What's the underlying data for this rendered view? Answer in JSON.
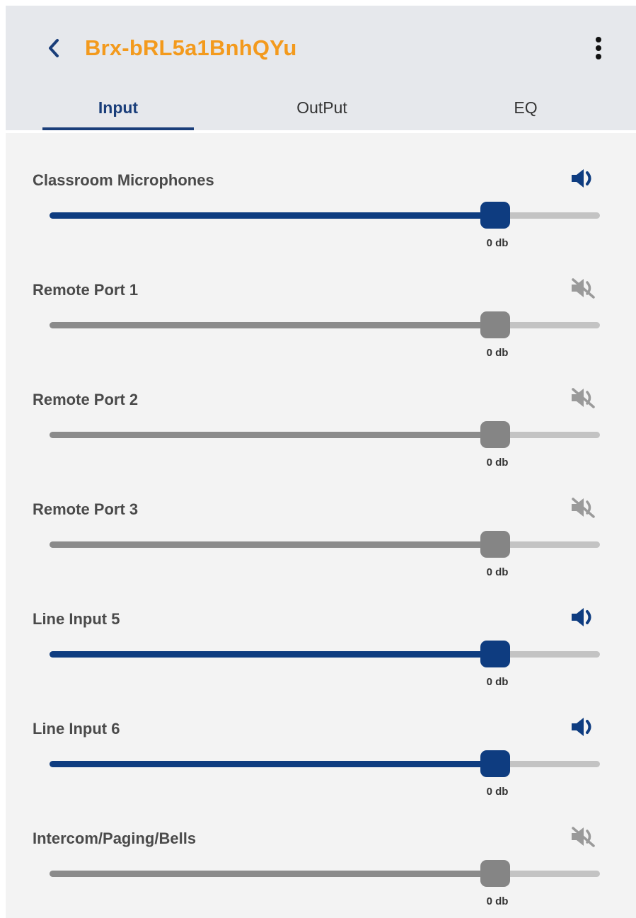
{
  "header": {
    "title": "Brx-bRL5a1BnhQYu",
    "back_icon": "chevron-left-icon",
    "menu_icon": "more-vertical-icon"
  },
  "tabs": [
    {
      "label": "Input",
      "active": true
    },
    {
      "label": "OutPut",
      "active": false
    },
    {
      "label": "EQ",
      "active": false
    }
  ],
  "colors": {
    "accent": "#0e3c80",
    "title": "#f39a1d",
    "muted": "#858585"
  },
  "channels": [
    {
      "label": "Classroom Microphones",
      "level": 0.81,
      "value": "0 db",
      "enabled": true,
      "icon": "speaker-icon"
    },
    {
      "label": "Remote Port 1",
      "level": 0.81,
      "value": "0 db",
      "enabled": false,
      "icon": "speaker-muted-icon"
    },
    {
      "label": "Remote Port 2",
      "level": 0.81,
      "value": "0 db",
      "enabled": false,
      "icon": "speaker-muted-icon"
    },
    {
      "label": "Remote Port 3",
      "level": 0.81,
      "value": "0 db",
      "enabled": false,
      "icon": "speaker-muted-icon"
    },
    {
      "label": "Line Input 5",
      "level": 0.81,
      "value": "0 db",
      "enabled": true,
      "icon": "speaker-icon"
    },
    {
      "label": "Line Input 6",
      "level": 0.81,
      "value": "0 db",
      "enabled": true,
      "icon": "speaker-icon"
    },
    {
      "label": "Intercom/Paging/Bells",
      "level": 0.81,
      "value": "0 db",
      "enabled": false,
      "icon": "speaker-muted-icon"
    }
  ]
}
